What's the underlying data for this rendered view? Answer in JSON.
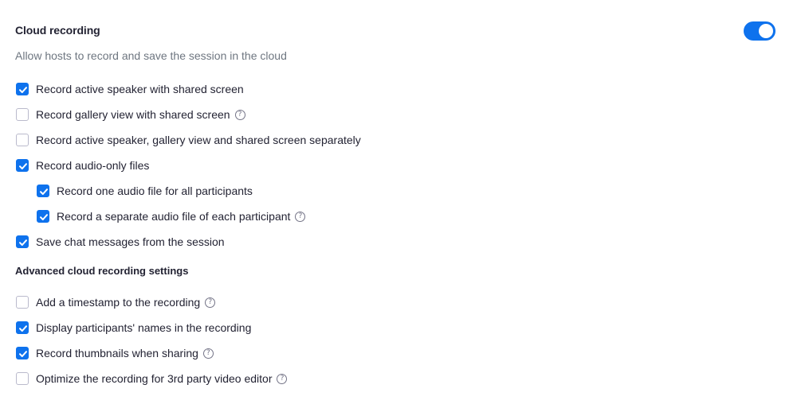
{
  "setting": {
    "title": "Cloud recording",
    "description": "Allow hosts to record and save the session in the cloud",
    "enabled": true
  },
  "options": [
    {
      "label": "Record active speaker with shared screen",
      "checked": true,
      "help": false
    },
    {
      "label": "Record gallery view with shared screen",
      "checked": false,
      "help": true
    },
    {
      "label": "Record active speaker, gallery view and shared screen separately",
      "checked": false,
      "help": false
    },
    {
      "label": "Record audio-only files",
      "checked": true,
      "help": false
    },
    {
      "label": "Record one audio file for all participants",
      "checked": true,
      "help": false
    },
    {
      "label": "Record a separate audio file of each participant",
      "checked": true,
      "help": true
    },
    {
      "label": "Save chat messages from the session",
      "checked": true,
      "help": false
    }
  ],
  "advanced": {
    "title": "Advanced cloud recording settings",
    "options": [
      {
        "label": "Add a timestamp to the recording",
        "checked": false,
        "help": true
      },
      {
        "label": "Display participants' names in the recording",
        "checked": true,
        "help": false
      },
      {
        "label": "Record thumbnails when sharing",
        "checked": true,
        "help": true
      },
      {
        "label": "Optimize the recording for 3rd party video editor",
        "checked": false,
        "help": true
      }
    ]
  },
  "icons": {
    "help_glyph": "?"
  },
  "colors": {
    "accent": "#0e72ed",
    "text": "#232333",
    "muted": "#6e7680",
    "checkbox_border": "#babacc"
  }
}
